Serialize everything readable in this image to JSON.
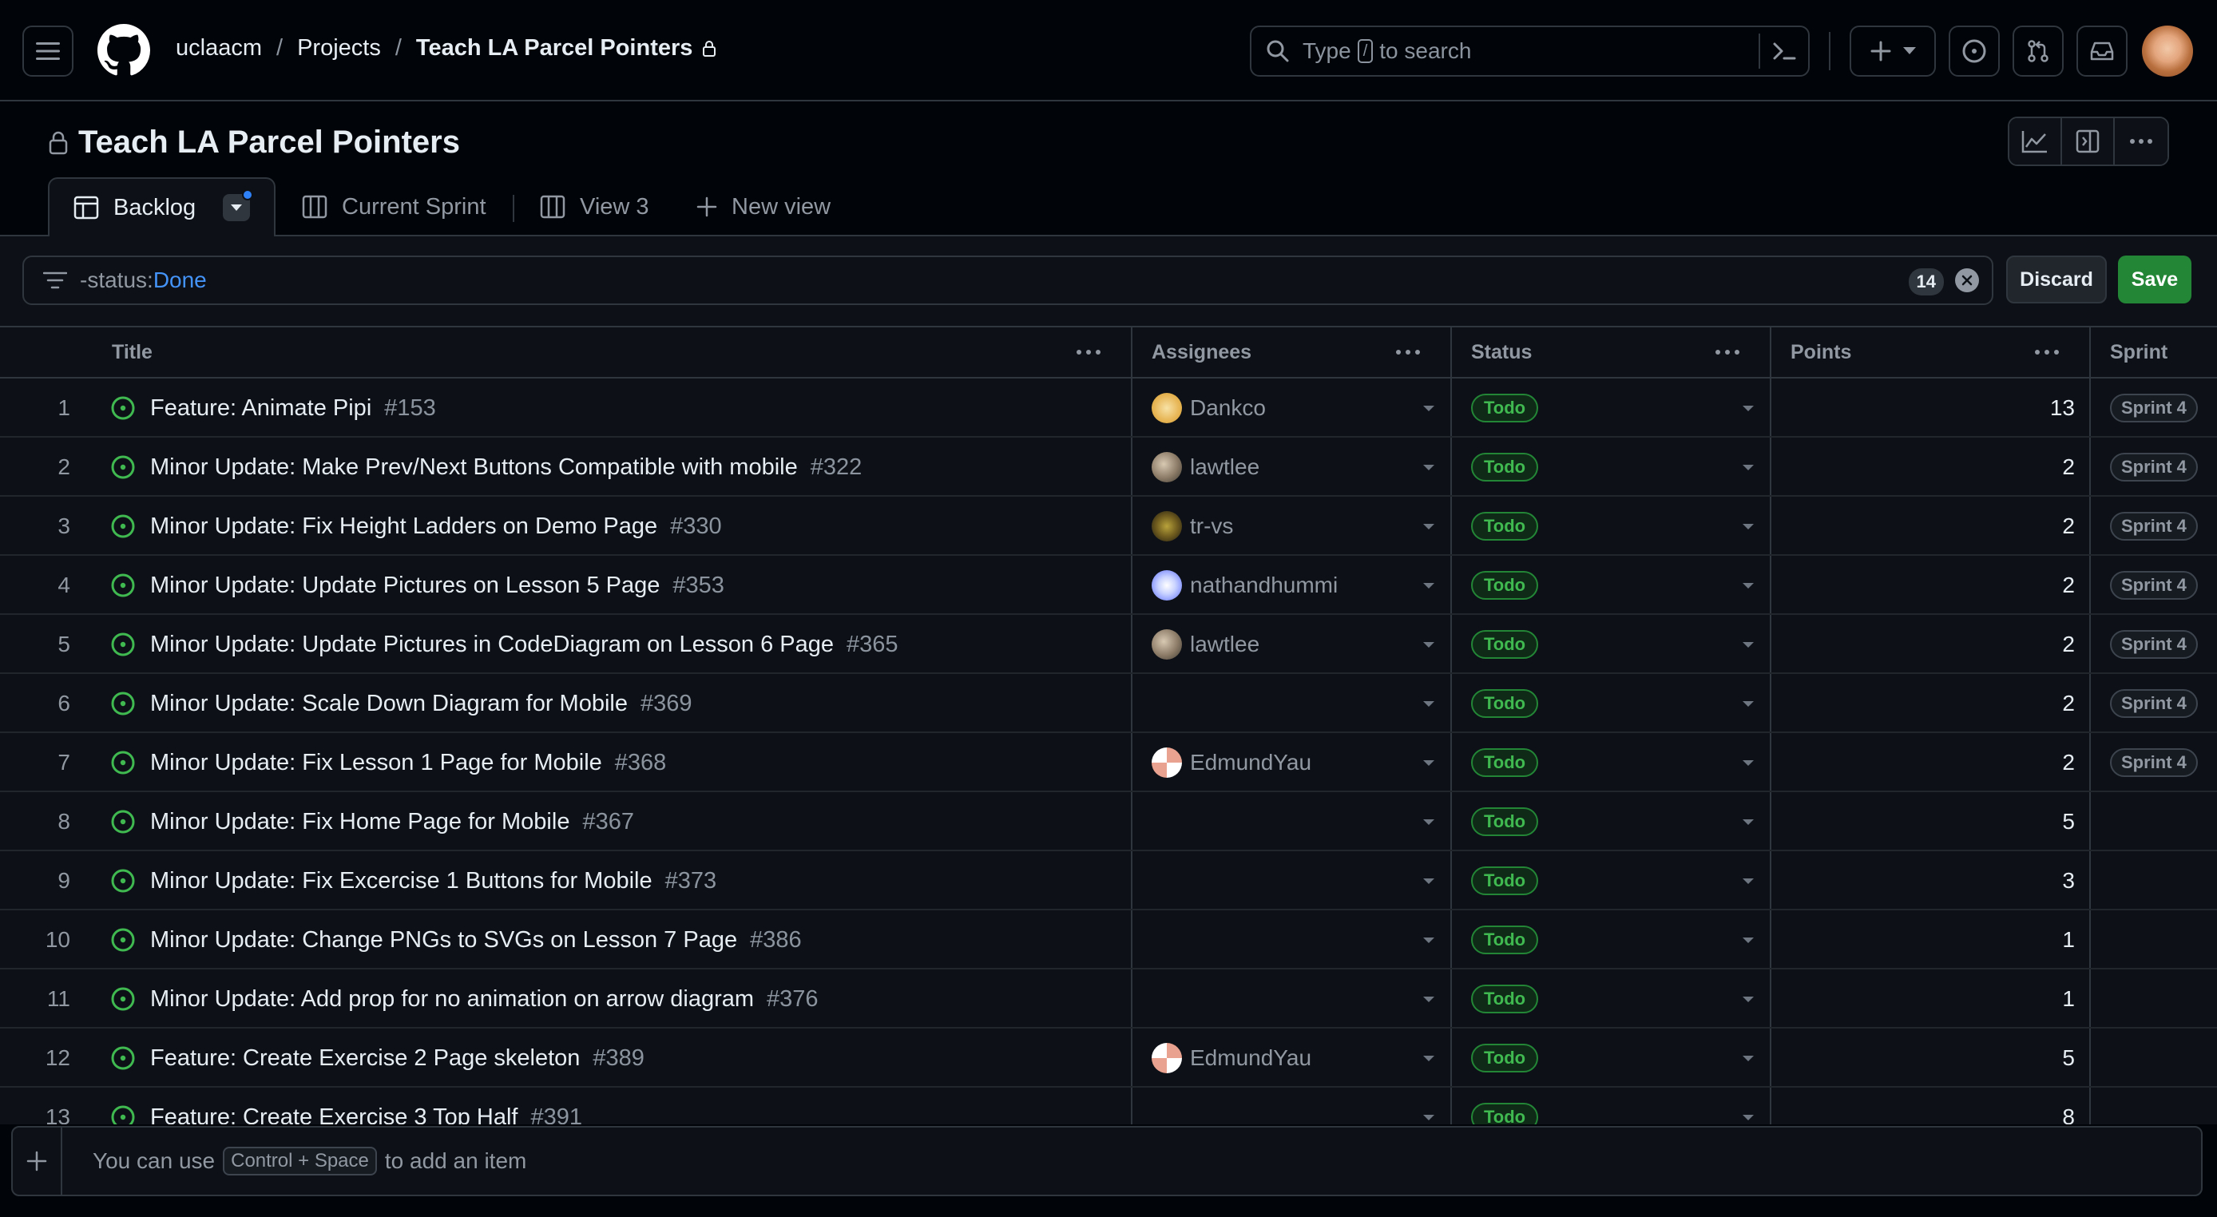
{
  "header": {
    "breadcrumb": {
      "org": "uclaacm",
      "section": "Projects",
      "current": "Teach LA Parcel Pointers",
      "sep1": "/",
      "sep2": "/"
    },
    "search": {
      "prefix": "Type",
      "key": "/",
      "suffix": "to search"
    }
  },
  "project": {
    "title": "Teach LA Parcel Pointers"
  },
  "tabs": [
    {
      "label": "Backlog"
    },
    {
      "label": "Current Sprint"
    },
    {
      "label": "View 3"
    },
    {
      "label": "New view"
    }
  ],
  "filter": {
    "key": "-status:",
    "value": "Done",
    "count": "14",
    "discard_label": "Discard",
    "save_label": "Save"
  },
  "columns": {
    "title": "Title",
    "assignees": "Assignees",
    "status": "Status",
    "points": "Points",
    "sprint": "Sprint"
  },
  "rows": [
    {
      "n": "1",
      "title": "Feature: Animate Pipi",
      "num": "#153",
      "assignee": "Dankco",
      "status": "Todo",
      "points": "13",
      "sprint": "Sprint 4"
    },
    {
      "n": "2",
      "title": "Minor Update: Make Prev/Next Buttons Compatible with mobile",
      "num": "#322",
      "assignee": "lawtlee",
      "status": "Todo",
      "points": "2",
      "sprint": "Sprint 4"
    },
    {
      "n": "3",
      "title": "Minor Update: Fix Height Ladders on Demo Page",
      "num": "#330",
      "assignee": "tr-vs",
      "status": "Todo",
      "points": "2",
      "sprint": "Sprint 4"
    },
    {
      "n": "4",
      "title": "Minor Update: Update Pictures on Lesson 5 Page",
      "num": "#353",
      "assignee": "nathandhummi",
      "status": "Todo",
      "points": "2",
      "sprint": "Sprint 4"
    },
    {
      "n": "5",
      "title": "Minor Update: Update Pictures in CodeDiagram on Lesson 6 Page",
      "num": "#365",
      "assignee": "lawtlee",
      "status": "Todo",
      "points": "2",
      "sprint": "Sprint 4"
    },
    {
      "n": "6",
      "title": "Minor Update: Scale Down Diagram for Mobile",
      "num": "#369",
      "assignee": "",
      "status": "Todo",
      "points": "2",
      "sprint": "Sprint 4"
    },
    {
      "n": "7",
      "title": "Minor Update: Fix Lesson 1 Page for Mobile",
      "num": "#368",
      "assignee": "EdmundYau",
      "status": "Todo",
      "points": "2",
      "sprint": "Sprint 4"
    },
    {
      "n": "8",
      "title": "Minor Update: Fix Home Page for Mobile",
      "num": "#367",
      "assignee": "",
      "status": "Todo",
      "points": "5",
      "sprint": ""
    },
    {
      "n": "9",
      "title": "Minor Update: Fix Excercise 1 Buttons for Mobile",
      "num": "#373",
      "assignee": "",
      "status": "Todo",
      "points": "3",
      "sprint": ""
    },
    {
      "n": "10",
      "title": "Minor Update: Change PNGs to SVGs on Lesson 7 Page",
      "num": "#386",
      "assignee": "",
      "status": "Todo",
      "points": "1",
      "sprint": ""
    },
    {
      "n": "11",
      "title": "Minor Update: Add prop for no animation on arrow diagram",
      "num": "#376",
      "assignee": "",
      "status": "Todo",
      "points": "1",
      "sprint": ""
    },
    {
      "n": "12",
      "title": "Feature: Create Exercise 2 Page skeleton",
      "num": "#389",
      "assignee": "EdmundYau",
      "status": "Todo",
      "points": "5",
      "sprint": ""
    },
    {
      "n": "13",
      "title": "Feature: Create Exercise 3 Top Half",
      "num": "#391",
      "assignee": "",
      "status": "Todo",
      "points": "8",
      "sprint": ""
    }
  ],
  "add_item": {
    "prefix": "You can use",
    "shortcut": "Control + Space",
    "suffix": "to add an item"
  },
  "colors": {
    "accent_green": "#238636",
    "status_green": "#3fb950",
    "link_blue": "#4493f8",
    "background": "#0d1117"
  }
}
